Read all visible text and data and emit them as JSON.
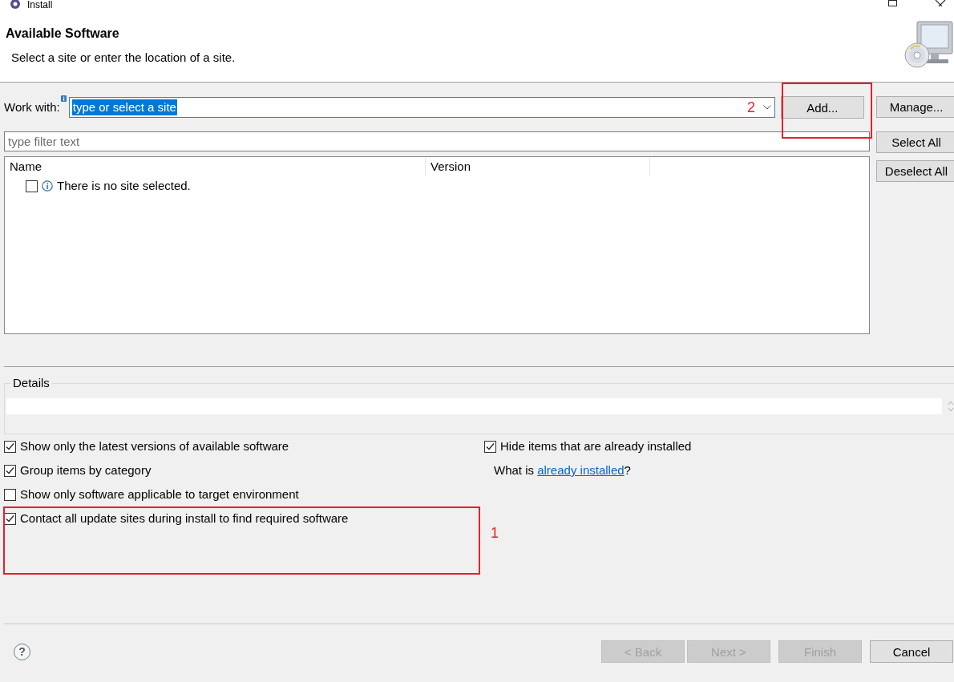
{
  "window": {
    "title": "Install"
  },
  "header": {
    "title": "Available Software",
    "description": "Select a site or enter the location of a site."
  },
  "work_with": {
    "label": "Work with:",
    "value": "type or select a site",
    "value_selected": true
  },
  "site_buttons": [
    {
      "label": "Add..."
    },
    {
      "label": "Manage..."
    }
  ],
  "filter": {
    "placeholder": "type filter text"
  },
  "selection_buttons": [
    {
      "label": "Select All"
    },
    {
      "label": "Deselect All"
    }
  ],
  "table": {
    "columns": [
      "Name",
      "Version"
    ],
    "rows": [
      {
        "kind": "info",
        "checked": false,
        "name": "There is no site selected."
      }
    ]
  },
  "details": {
    "label": "Details"
  },
  "options": [
    {
      "label": "Show only the latest versions of available software",
      "checked": true
    },
    {
      "label": "Group items by category",
      "checked": true
    },
    {
      "label": "Show only software applicable to target environment",
      "checked": false
    },
    {
      "label": "Contact all update sites during install to find required software",
      "checked": true
    }
  ],
  "installed_options": [
    {
      "label": "Hide items that are already installed",
      "checked": true
    }
  ],
  "installed_note": {
    "before": "What is",
    "link": "already installed",
    "after": "?"
  },
  "help": {
    "label": "?"
  },
  "nav_buttons": [
    {
      "label": "< Back",
      "disabled": true
    },
    {
      "label": "Next >",
      "disabled": true
    },
    {
      "label": "Finish",
      "disabled": true
    },
    {
      "label": "Cancel",
      "disabled": false
    }
  ],
  "annotations": [
    {
      "kind": "add-button",
      "label": "2"
    },
    {
      "kind": "options",
      "label": "1"
    }
  ]
}
